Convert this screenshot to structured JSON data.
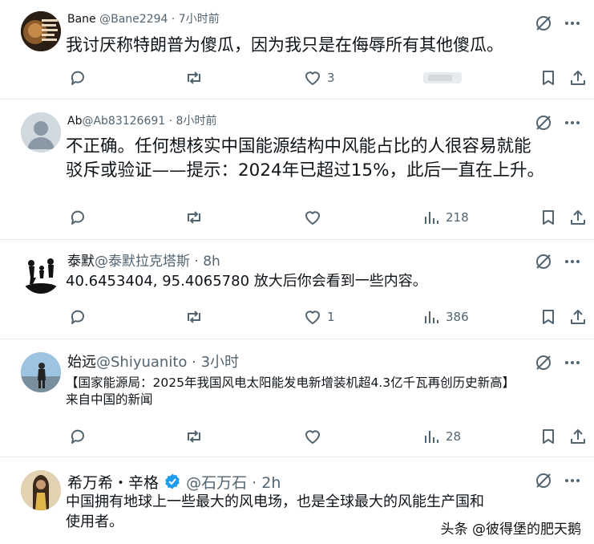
{
  "posts": [
    {
      "display_name": "Bane",
      "handle": "@Bane2294",
      "time": "· 7小时前",
      "text": "我讨厌称特朗普为傻瓜，因为我只是在侮辱所有其他傻瓜。",
      "likes": "3",
      "views": ""
    },
    {
      "display_name": "Ab",
      "handle": "@Ab83126691",
      "time": "· 8小时前",
      "text_line1": "不正确。任何想核实中国能源结构中风能占比的人很容易就能",
      "text_line2": "驳斥或验证——提示：2024年已超过15%，此后一直在上升。",
      "likes": "",
      "views": "218"
    },
    {
      "display_name": "泰默",
      "handle": "@泰默拉克塔斯",
      "time": "· 8h",
      "text": "40.6453404, 95.4065780 放大后你会看到一些内容。",
      "likes": "1",
      "views": "386"
    },
    {
      "display_name": "始远",
      "handle": "@Shiyuanito",
      "time": "· 3小时",
      "text_line1": "【国家能源局：2025年我国风电太阳能发电新增装机超4.3亿千瓦再创历史新高】",
      "text_line2": "来自中国的新闻",
      "likes": "",
      "views": "28"
    },
    {
      "display_name": "希万希・辛格",
      "handle": "@石万石",
      "time": "· 2h",
      "text_line1": "中国拥有地球上一些最大的风电场，也是全球最大的风能生产国和",
      "text_line2": "使用者。"
    }
  ],
  "watermark": "头条 @彼得堡的肥天鹅",
  "icons": {
    "reply": "speech-bubble-icon",
    "repost": "repost-arrows-icon",
    "like": "heart-icon",
    "views": "bar-chart-icon",
    "bookmark": "bookmark-icon",
    "share": "share-upload-icon",
    "grok": "grok-slash-circle-icon",
    "more": "more-dots-icon"
  },
  "colors": {
    "text": "#0f1419",
    "secondary": "#536471",
    "divider": "#e6e9ec",
    "verified": "#1d9bf0"
  }
}
